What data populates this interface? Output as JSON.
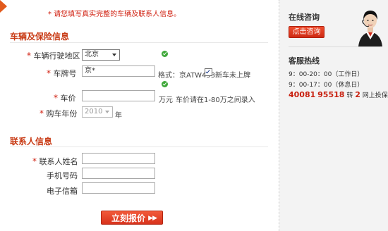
{
  "notice": "* 请您填写真实完整的车辆及联系人信息。",
  "vehicle": {
    "title": "车辆及保险信息",
    "region_label": "车辆行驶地区",
    "region_value": "北京",
    "plate_label": "车牌号",
    "plate_value": "京*",
    "plate_hint": "格式：京ATW453",
    "new_car_label": "新车未上牌",
    "price_label": "车价",
    "price_unit": "万元",
    "price_hint": "车价请在1-80万之间录入",
    "year_label": "购车年份",
    "year_value": "2010",
    "year_unit": "年"
  },
  "contact": {
    "title": "联系人信息",
    "name_label": "联系人姓名",
    "phone_label": "手机号码",
    "email_label": "电子信箱"
  },
  "submit_label": "立刻报价",
  "submit_arrows": "▶▶",
  "sidebar": {
    "consult_title": "在线咨询",
    "consult_button": "点击咨询",
    "hotline_title": "客服热线",
    "hours_workday": "9：00-20：00（工作日）",
    "hours_holiday": "9：00-17：00（休息日）",
    "phone_part1": "40081",
    "phone_part2": "95518",
    "phone_ext_prefix": "转",
    "phone_ext": "2",
    "phone_suffix": "网上投保"
  },
  "colors": {
    "accent": "#c83a14",
    "required": "#d02010",
    "button": "#d8321c",
    "ok": "#3fa83a"
  }
}
